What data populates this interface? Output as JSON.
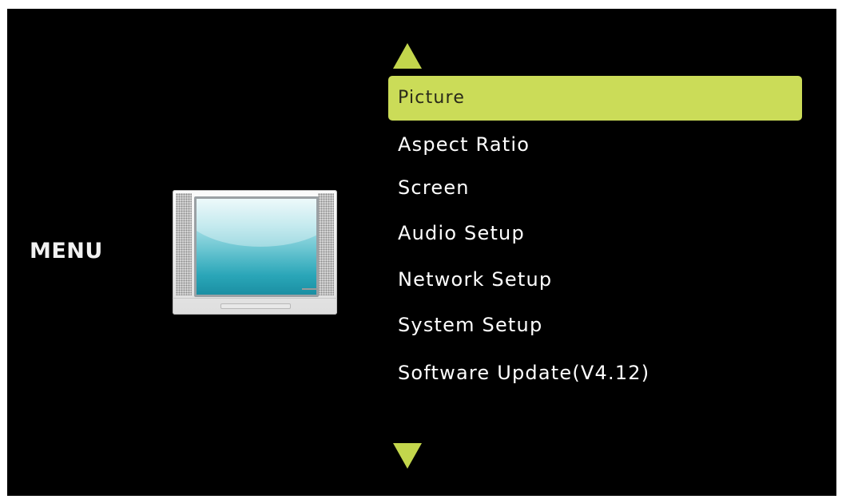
{
  "menu": {
    "title": "MENU",
    "items": [
      {
        "label": "Picture",
        "selected": true
      },
      {
        "label": "Aspect Ratio",
        "selected": false
      },
      {
        "label": "Screen",
        "selected": false
      },
      {
        "label": "Audio Setup",
        "selected": false
      },
      {
        "label": "Network Setup",
        "selected": false
      },
      {
        "label": "System Setup",
        "selected": false
      },
      {
        "label": "Software Update(V4.12)",
        "selected": false
      }
    ]
  },
  "icons": {
    "category_icon": "tv-icon",
    "scroll_up": "arrow-up-icon",
    "scroll_down": "arrow-down-icon"
  },
  "colors": {
    "background": "#000000",
    "highlight": "#cbdc58",
    "arrow": "#c3d64c",
    "text": "#ffffff"
  }
}
